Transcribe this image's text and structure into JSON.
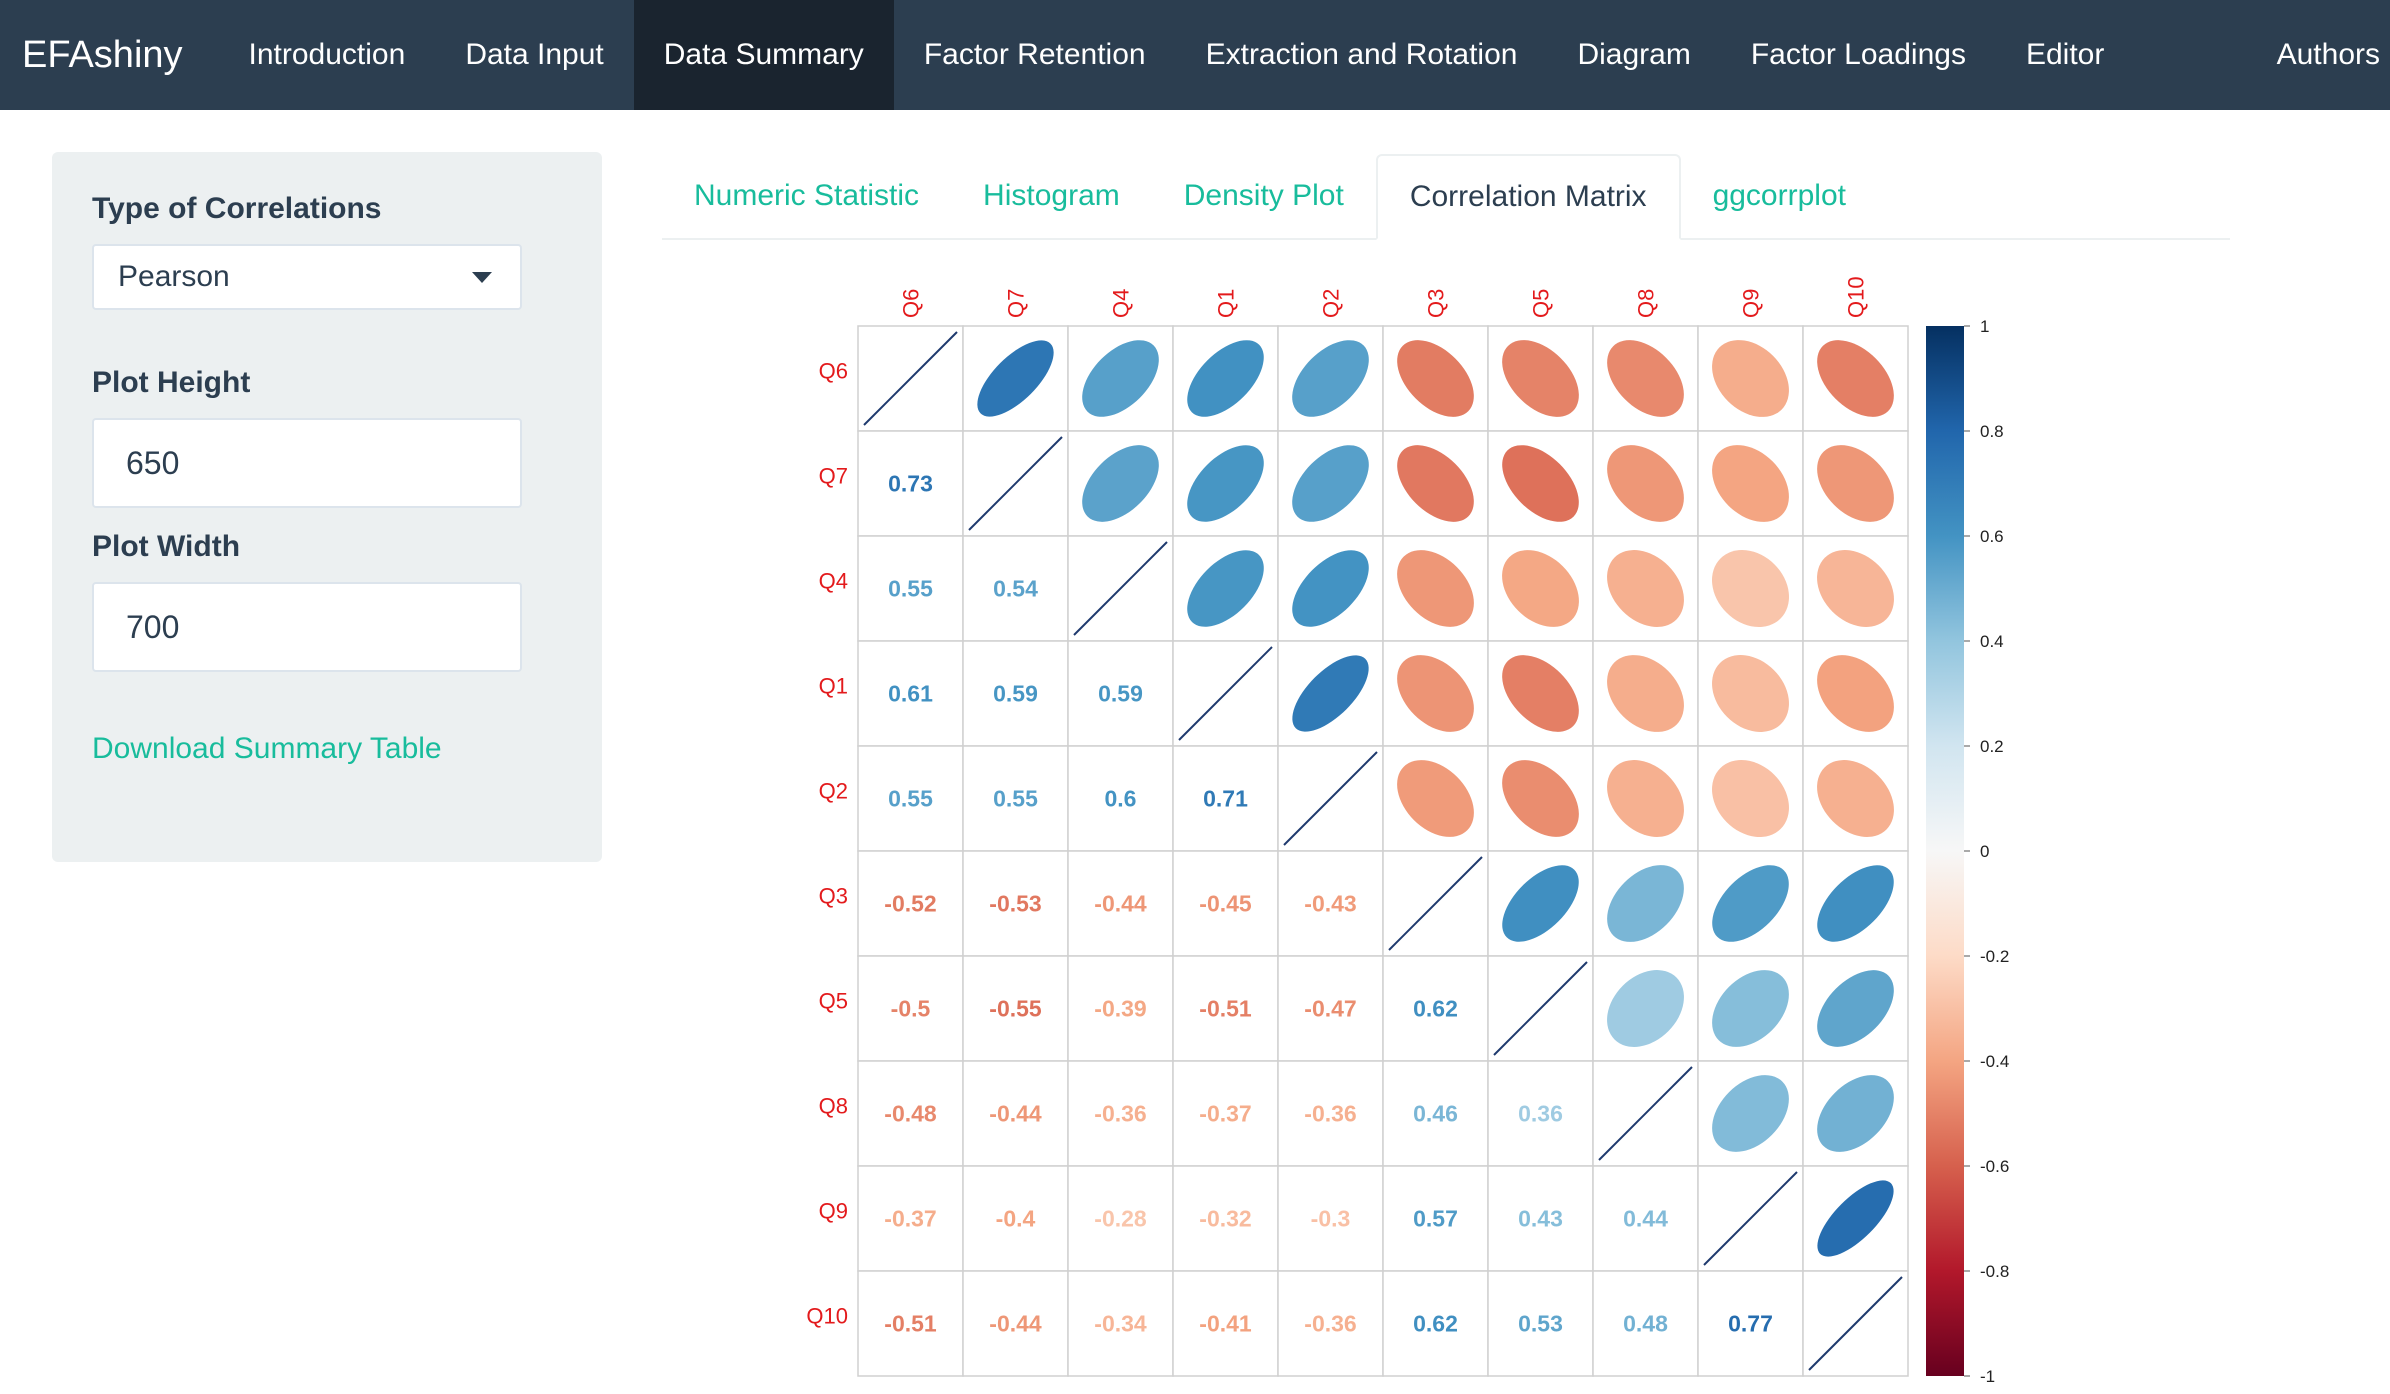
{
  "navbar": {
    "brand": "EFAshiny",
    "items": [
      "Introduction",
      "Data Input",
      "Data Summary",
      "Factor Retention",
      "Extraction and Rotation",
      "Diagram",
      "Factor Loadings",
      "Editor"
    ],
    "active": "Data Summary",
    "right_item": "Authors"
  },
  "sidebar": {
    "type_label": "Type of Correlations",
    "type_value": "Pearson",
    "height_label": "Plot Height",
    "height_value": "650",
    "width_label": "Plot Width",
    "width_value": "700",
    "download_label": "Download Summary Table"
  },
  "tabs": {
    "items": [
      "Numeric Statistic",
      "Histogram",
      "Density Plot",
      "Correlation Matrix",
      "ggcorrplot"
    ],
    "active": "Correlation Matrix"
  },
  "colors": {
    "navbar_bg": "#2c3e50",
    "navbar_active": "#1a242f",
    "accent": "#18bc9c",
    "label_red": "#e31a1c"
  },
  "chart_data": {
    "type": "heatmap",
    "variables": [
      "Q6",
      "Q7",
      "Q4",
      "Q1",
      "Q2",
      "Q3",
      "Q5",
      "Q8",
      "Q9",
      "Q10"
    ],
    "matrix": [
      [
        1,
        0.73,
        0.55,
        0.61,
        0.55,
        -0.52,
        -0.5,
        -0.48,
        -0.37,
        -0.51
      ],
      [
        0.73,
        1,
        0.54,
        0.59,
        0.55,
        -0.53,
        -0.55,
        -0.44,
        -0.4,
        -0.44
      ],
      [
        0.55,
        0.54,
        1,
        0.59,
        0.6,
        -0.44,
        -0.39,
        -0.36,
        -0.28,
        -0.34
      ],
      [
        0.61,
        0.59,
        0.59,
        1,
        0.71,
        -0.45,
        -0.51,
        -0.37,
        -0.32,
        -0.41
      ],
      [
        0.55,
        0.55,
        0.6,
        0.71,
        1,
        -0.43,
        -0.47,
        -0.36,
        -0.3,
        -0.36
      ],
      [
        -0.52,
        -0.53,
        -0.44,
        -0.45,
        -0.43,
        1,
        0.62,
        0.46,
        0.57,
        0.62
      ],
      [
        -0.5,
        -0.55,
        -0.39,
        -0.51,
        -0.47,
        0.62,
        1,
        0.36,
        0.43,
        0.53
      ],
      [
        -0.48,
        -0.44,
        -0.36,
        -0.37,
        -0.36,
        0.46,
        0.36,
        1,
        0.44,
        0.48
      ],
      [
        -0.37,
        -0.4,
        -0.28,
        -0.32,
        -0.3,
        0.57,
        0.43,
        0.44,
        1,
        0.77
      ],
      [
        -0.51,
        -0.44,
        -0.34,
        -0.41,
        -0.36,
        0.62,
        0.53,
        0.48,
        0.77,
        1
      ]
    ],
    "lower": "number",
    "upper": "ellipse",
    "diagonal": "line",
    "colorbar_ticks": [
      "1",
      "0.8",
      "0.6",
      "0.4",
      "0.2",
      "0",
      "-0.2",
      "-0.4",
      "-0.6",
      "-0.8",
      "-1"
    ],
    "range": [
      -1,
      1
    ]
  }
}
